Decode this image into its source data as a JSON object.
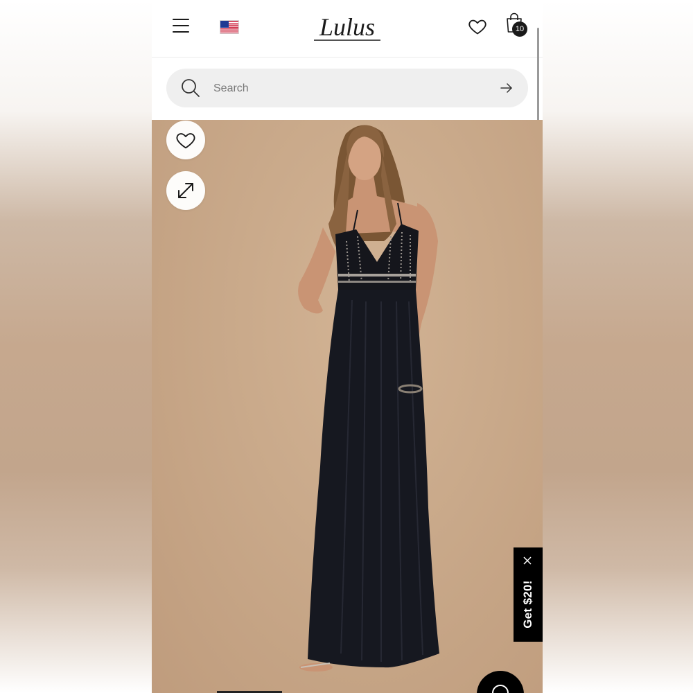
{
  "header": {
    "menu_icon": "hamburger-menu-icon",
    "flag_icon": "us-flag-icon",
    "logo_text": "Lulus",
    "wishlist_icon": "heart-outline-icon",
    "bag_icon": "shopping-bag-icon",
    "bag_count": "10"
  },
  "search": {
    "placeholder": "Search",
    "value": "",
    "icon": "search-icon",
    "submit_icon": "arrow-right-icon"
  },
  "product": {
    "favorite_icon": "heart-outline-icon",
    "expand_icon": "expand-arrows-icon"
  },
  "promo": {
    "label": "Get $20!",
    "close_icon": "close-icon"
  },
  "chat": {
    "icon": "chat-bubble-icon"
  },
  "colors": {
    "text_primary": "#1a1a1a",
    "search_bg": "#efefef",
    "product_bg": "#c9a98a",
    "promo_bg": "#000000",
    "badge_bg": "#1a1a1a"
  }
}
